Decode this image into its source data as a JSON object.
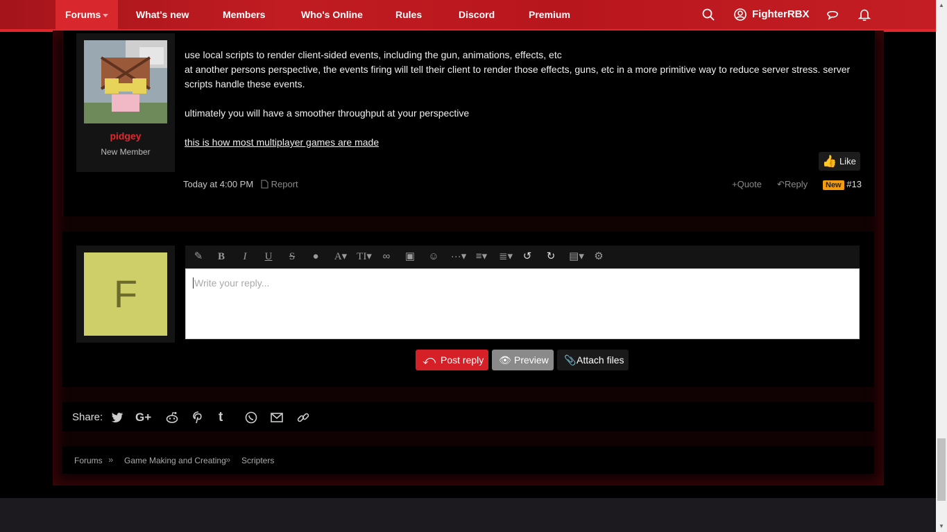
{
  "nav": {
    "tabs": [
      {
        "label": "Forums"
      },
      {
        "label": "What's new"
      },
      {
        "label": "Members"
      },
      {
        "label": "Who's Online"
      },
      {
        "label": "Rules"
      },
      {
        "label": "Discord"
      },
      {
        "label": "Premium"
      }
    ],
    "username": "FighterRBX"
  },
  "post": {
    "author": "pidgey",
    "user_title": "New Member",
    "lines": [
      "use local scripts to render client-sided events, including the gun, animations, effects, etc",
      "at another persons perspective, the events firing will tell their client to render those effects, guns, etc in a more primitive way to reduce server stress. server scripts handle these events.",
      "ultimately you will have a smoother throughput at your perspective",
      "this is how most multiplayer games are made"
    ],
    "like_label": "Like",
    "timestamp": "Today at 4:00 PM",
    "report_label": "Report",
    "quote_label": "Quote",
    "reply_label": "Reply",
    "new_badge": "New",
    "post_number": "#13"
  },
  "reply": {
    "avatar_letter": "F",
    "placeholder": "Write your reply...",
    "post_reply_label": "Post reply",
    "preview_label": "Preview",
    "attach_label": "Attach files"
  },
  "share": {
    "label": "Share:"
  },
  "breadcrumb": [
    "Forums",
    "Game Making and Creating",
    "Scripters"
  ],
  "colors": {
    "accent": "#d52027",
    "nav": "#c01c22",
    "badge": "#f39c12",
    "avatar_bg": "#cfcf6a"
  }
}
